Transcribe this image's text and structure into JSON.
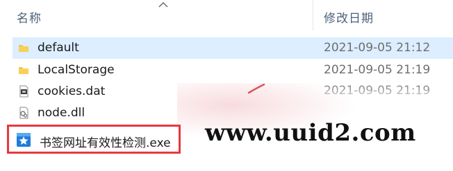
{
  "header": {
    "name_label": "名称",
    "date_label": "修改日期"
  },
  "files": [
    {
      "name": "default",
      "date": "2021-09-05 21:12",
      "icon": "folder-icon",
      "selected": true
    },
    {
      "name": "LocalStorage",
      "date": "2021-09-05 21:19",
      "icon": "folder-icon",
      "selected": false
    },
    {
      "name": "cookies.dat",
      "date": "2021-09-05 21:19",
      "icon": "dat-file-icon",
      "selected": false
    },
    {
      "name": "node.dll",
      "date": "",
      "icon": "dll-file-icon",
      "selected": false
    },
    {
      "name": "书签网址有效性检测.exe",
      "date": "",
      "icon": "exe-star-icon",
      "selected": false
    }
  ],
  "watermark": "www.uuid2.com",
  "colors": {
    "selection": "#dceeff",
    "highlight_border": "#e8383c",
    "folder": "#f5c343",
    "header_text": "#4c607a",
    "date_text": "#6e6e6e"
  }
}
